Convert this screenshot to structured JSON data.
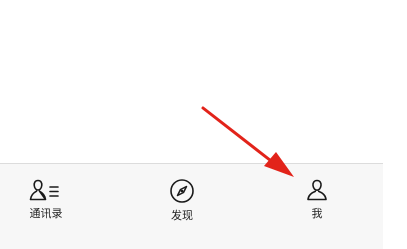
{
  "tabbar": {
    "items": [
      {
        "label": "通讯录",
        "icon": "contacts-icon"
      },
      {
        "label": "发现",
        "icon": "compass-icon"
      },
      {
        "label": "我",
        "icon": "person-icon"
      }
    ]
  },
  "annotation": {
    "icon": "red-arrow",
    "color": "#e2231a"
  },
  "colors": {
    "tabbar_bg": "#f7f7f7",
    "icon": "#1a1a1a"
  }
}
